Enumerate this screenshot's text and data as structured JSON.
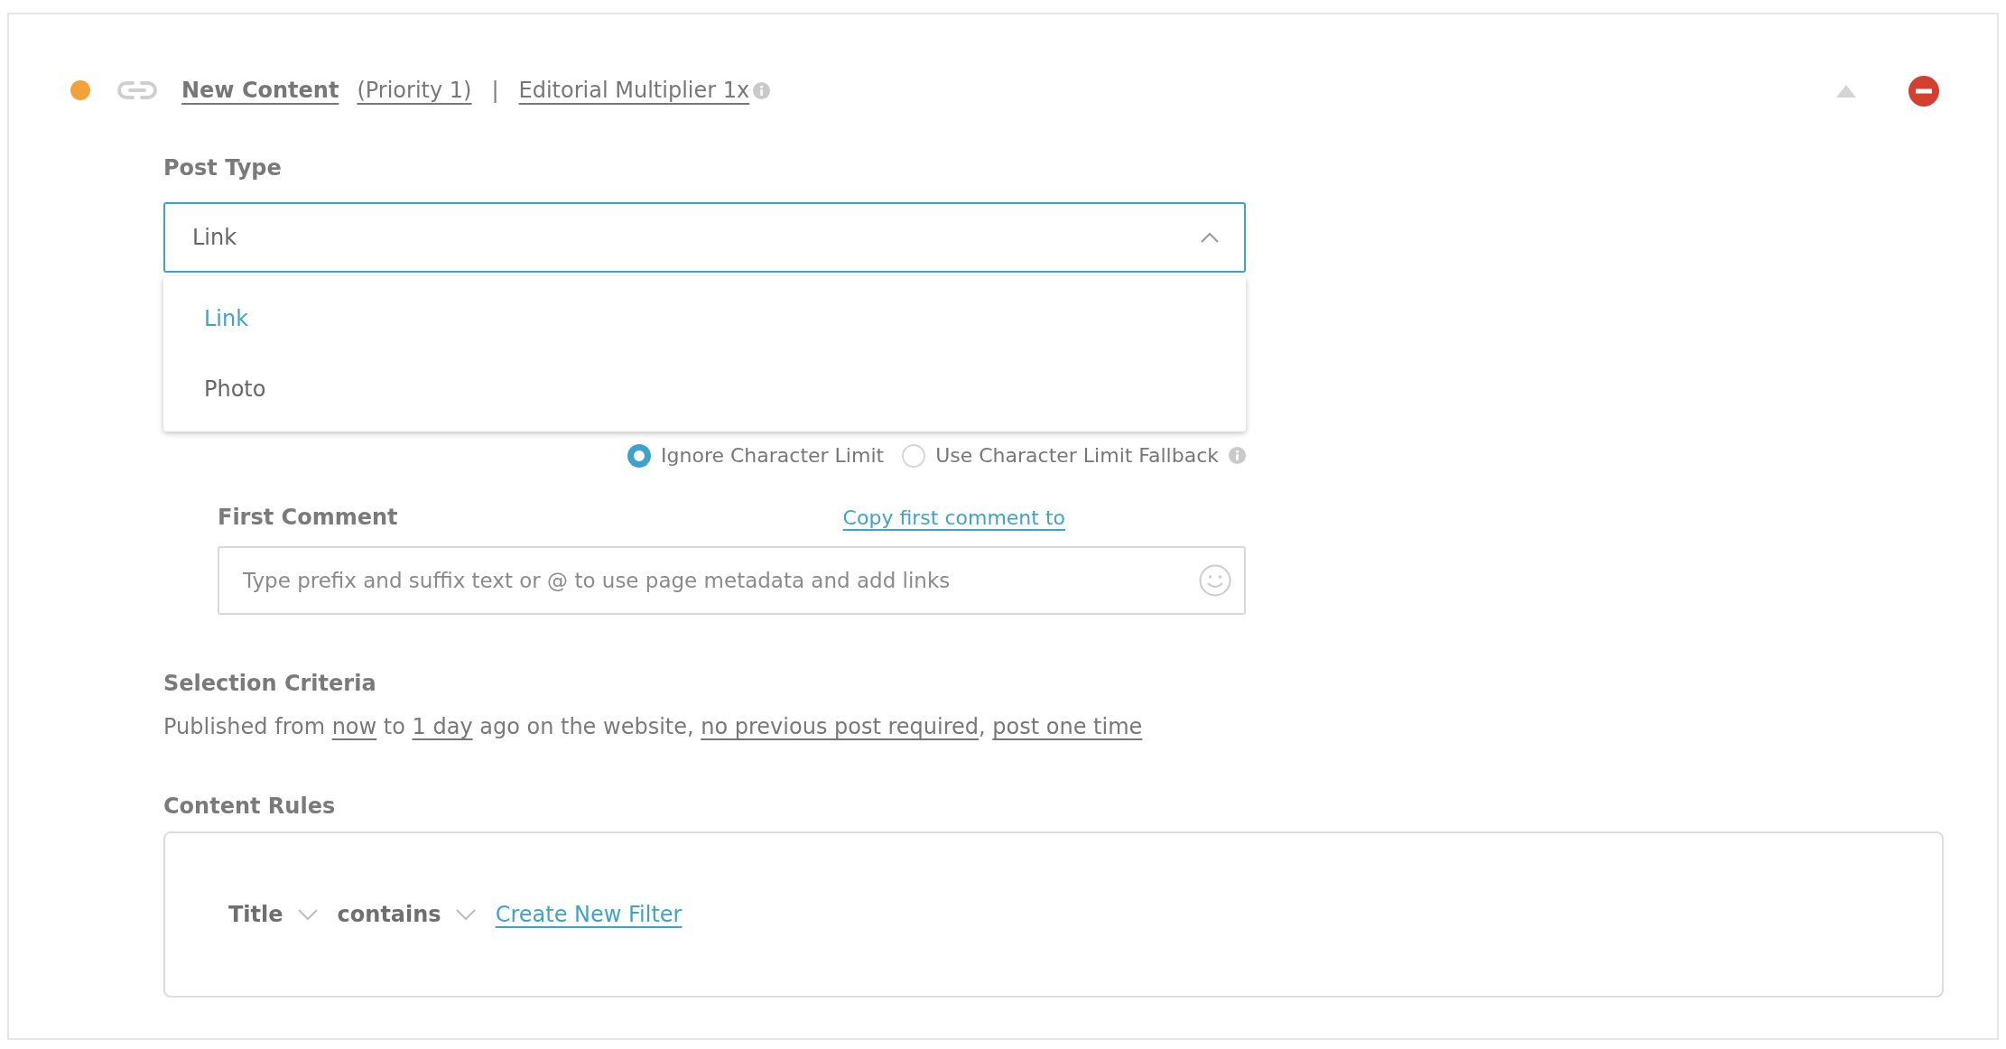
{
  "header": {
    "title": "New Content",
    "priority": "(Priority 1)",
    "separator": "|",
    "multiplier": "Editorial Multiplier 1x"
  },
  "post_type": {
    "label": "Post Type",
    "value": "Link",
    "expanded": true,
    "options": [
      {
        "label": "Link",
        "selected": true
      },
      {
        "label": "Photo",
        "selected": false
      }
    ]
  },
  "character_limit": [
    {
      "label": "Ignore Character Limit",
      "selected": true,
      "has_info": false
    },
    {
      "label": "Use Character Limit Fallback",
      "selected": false,
      "has_info": true
    }
  ],
  "first_comment": {
    "label": "First Comment",
    "copy_link": "Copy first comment to",
    "placeholder": "Type prefix and suffix text or @ to use page metadata and add links"
  },
  "selection_criteria": {
    "label": "Selection Criteria",
    "parts": [
      {
        "kind": "text",
        "text": "Published from "
      },
      {
        "kind": "link",
        "text": "now"
      },
      {
        "kind": "text",
        "text": " to "
      },
      {
        "kind": "link",
        "text": "1 day"
      },
      {
        "kind": "text",
        "text": " ago on the website, "
      },
      {
        "kind": "link",
        "text": "no previous post required"
      },
      {
        "kind": "text",
        "text": ", "
      },
      {
        "kind": "link",
        "text": "post one time"
      }
    ]
  },
  "content_rules": {
    "label": "Content Rules",
    "filters": [
      {
        "label": "Title"
      },
      {
        "label": "contains"
      }
    ],
    "create_link": "Create New Filter"
  }
}
